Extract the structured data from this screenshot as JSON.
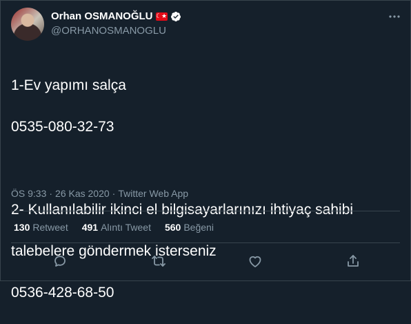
{
  "user": {
    "display_name": "Orhan OSMANOĞLU",
    "flag": "☾★",
    "handle": "@ORHANOSMANOGLU"
  },
  "tweet": {
    "lines": [
      "1-Ev yapımı salça",
      "0535-080-32-73",
      "",
      "2- Kullanılabilir ikinci el bilgisayarlarınızı ihtiyaç sahibi",
      "talebelere göndermek isterseniz",
      "0536-428-68-50"
    ]
  },
  "meta": {
    "time": "ÖS 9:33",
    "sep1": "·",
    "date": "26 Kas 2020",
    "sep2": "·",
    "source": "Twitter Web App"
  },
  "stats": {
    "retweets": {
      "count": "130",
      "label": "Retweet"
    },
    "quotes": {
      "count": "491",
      "label": "Alıntı Tweet"
    },
    "likes": {
      "count": "560",
      "label": "Beğeni"
    }
  },
  "colors": {
    "background": "#15202b",
    "secondary_text": "#8899a6",
    "verified": "#ffffff",
    "border": "#38444d"
  }
}
